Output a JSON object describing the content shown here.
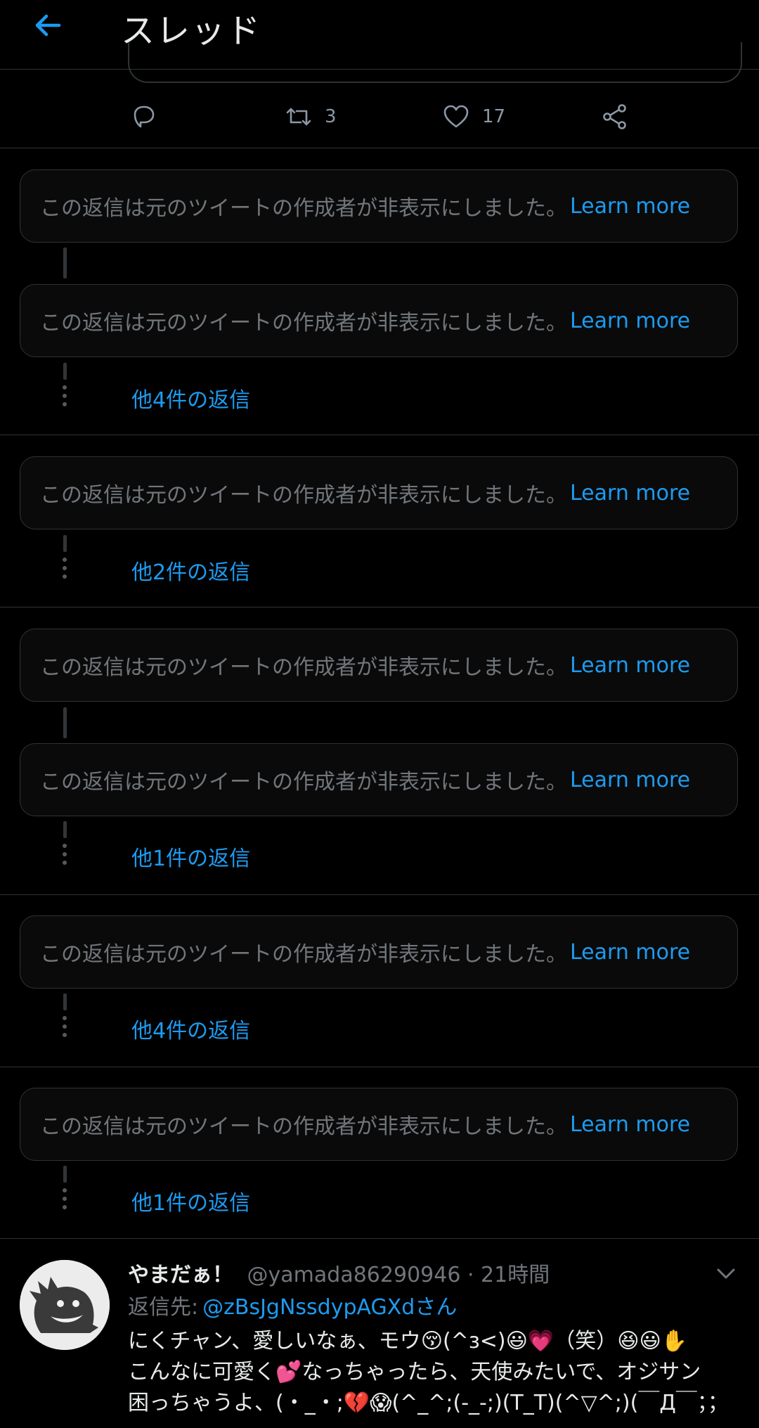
{
  "header": {
    "title": "スレッド"
  },
  "tweet_actions": {
    "retweet_count": "3",
    "like_count": "17"
  },
  "hidden_notice": {
    "text": "この返信は元のツイートの作成者が非表示にしました。",
    "learn_more": "Learn more"
  },
  "more_replies": {
    "group1": "他4件の返信",
    "group2": "他2件の返信",
    "group3": "他1件の返信",
    "group4": "他4件の返信",
    "group5": "他1件の返信"
  },
  "reply_tweet": {
    "name": "やまだぁ！",
    "handle_time": "@yamada86290946 · 21時間",
    "reply_to_label": "返信先:",
    "reply_to_user": "@zBsJgNssdypAGXdさん",
    "lines": [
      "にくチャン、愛しいなぁ、モウ😚(^з<)😃💗（笑）😆😃✋",
      "こんなに可愛く💕なっちゃったら、天使みたいで、オジサン",
      "困っちゃうよ、(・_・;💔😱(^_^;(-_-;)(T_T)(^▽^;)(￣Д￣；；"
    ]
  },
  "colors": {
    "accent": "#1d9bf0",
    "muted": "#71767b",
    "border": "#2f3336",
    "background": "#000000"
  },
  "icons": [
    "back-arrow-icon",
    "reply-icon",
    "retweet-icon",
    "like-icon",
    "share-icon",
    "chevron-down-icon",
    "dots-icon"
  ]
}
